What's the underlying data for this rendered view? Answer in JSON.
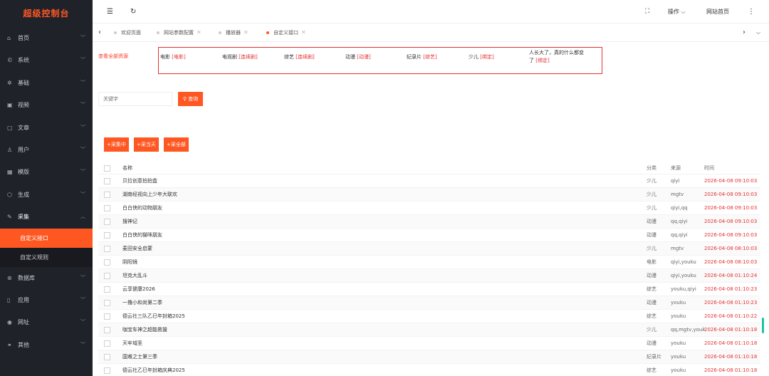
{
  "brand": "超级控制台",
  "sidebar": {
    "items": [
      {
        "icon": "⌂",
        "label": "首页"
      },
      {
        "icon": "©",
        "label": "系统"
      },
      {
        "icon": "✲",
        "label": "基础"
      },
      {
        "icon": "▣",
        "label": "视频"
      },
      {
        "icon": "▢",
        "label": "文章"
      },
      {
        "icon": "♙",
        "label": "用户"
      },
      {
        "icon": "▦",
        "label": "模版"
      },
      {
        "icon": "⬡",
        "label": "生成"
      },
      {
        "icon": "✎",
        "label": "采集"
      }
    ],
    "sub": [
      {
        "label": "自定义接口",
        "active": true
      },
      {
        "label": "自定义规则",
        "active": false
      }
    ],
    "items2": [
      {
        "icon": "⊛",
        "label": "数据库"
      },
      {
        "icon": "▯",
        "label": "应用"
      },
      {
        "icon": "◉",
        "label": "网址"
      },
      {
        "icon": "⚭",
        "label": "其他"
      }
    ]
  },
  "header": {
    "menu_icon": "☰",
    "refresh_icon": "↻",
    "fullscreen_icon": "⛶",
    "ops": "操作",
    "site_home": "网站首页",
    "more_icon": "⋮"
  },
  "tabs": [
    {
      "label": "欢迎页面",
      "closable": false,
      "active": false
    },
    {
      "label": "网站参数配置",
      "closable": true,
      "active": false
    },
    {
      "label": "播放器",
      "closable": true,
      "active": false
    },
    {
      "label": "自定义接口",
      "closable": true,
      "active": true
    }
  ],
  "main": {
    "res_all": "查看全部资源",
    "cats": [
      {
        "name": "电影",
        "tag": "[电影]"
      },
      {
        "name": "电视剧",
        "tag": "[连续剧]"
      },
      {
        "name": "综艺",
        "tag": "[连续剧]"
      },
      {
        "name": "动漫",
        "tag": "[动漫]"
      },
      {
        "name": "纪录片",
        "tag": "[综艺]"
      },
      {
        "name": "少儿",
        "tag": "[绑定]"
      },
      {
        "name": "人长大了，真的什么都变了",
        "tag": "[绑定]"
      }
    ],
    "search_placeholder": "关键字",
    "query": "查询",
    "ops": [
      "+采集中",
      "+采当天",
      "+采全部"
    ]
  },
  "table": {
    "headers": {
      "name": "名称",
      "cat": "分类",
      "src": "来源",
      "time": "时间"
    },
    "rows": [
      {
        "name": "贝拉创意拍拍盒",
        "cat": "少儿",
        "src": "qiyi",
        "time": "2026-04-08 09:10:03"
      },
      {
        "name": "湖南经视向上少年大联欢",
        "cat": "少儿",
        "src": "mgtv",
        "time": "2026-04-08 09:10:03"
      },
      {
        "name": "白白侠的动物朋友",
        "cat": "少儿",
        "src": "qiyi,qq",
        "time": "2026-04-08 09:10:03"
      },
      {
        "name": "搜神记",
        "cat": "动漫",
        "src": "qq,qiyi",
        "time": "2026-04-08 09:10:03"
      },
      {
        "name": "白白侠的猫咪朋友",
        "cat": "动漫",
        "src": "qq,qiyi",
        "time": "2026-04-08 09:10:03"
      },
      {
        "name": "麦田安全启蒙",
        "cat": "少儿",
        "src": "mgtv",
        "time": "2026-04-08 08:10:03"
      },
      {
        "name": "阴阳镜",
        "cat": "电影",
        "src": "qiyi,youku",
        "time": "2026-04-08 08:10:03"
      },
      {
        "name": "坦克大乱斗",
        "cat": "动漫",
        "src": "qiyi,youku",
        "time": "2026-04-08 01:10:24"
      },
      {
        "name": "云享健康2026",
        "cat": "综艺",
        "src": "youku,qiyi",
        "time": "2026-04-08 01:10:23"
      },
      {
        "name": "一撸小和尚第二季",
        "cat": "动漫",
        "src": "youku",
        "time": "2026-04-08 01:10:23"
      },
      {
        "name": "德云社三队乙巳年封箱2025",
        "cat": "综艺",
        "src": "youku",
        "time": "2026-04-08 01:10:22"
      },
      {
        "name": "咖宝车神之超能救援",
        "cat": "少儿",
        "src": "qq,mgtv,youku",
        "time": "2026-04-08 01:10:18"
      },
      {
        "name": "天牢域圣",
        "cat": "动漫",
        "src": "youku",
        "time": "2026-04-08 01:10:18"
      },
      {
        "name": "国难之士第三季",
        "cat": "纪录片",
        "src": "youku",
        "time": "2026-04-08 01:10:18"
      },
      {
        "name": "德云社乙巳年封箱庆典2025",
        "cat": "综艺",
        "src": "youku",
        "time": "2026-04-08 01:10:18"
      }
    ]
  }
}
